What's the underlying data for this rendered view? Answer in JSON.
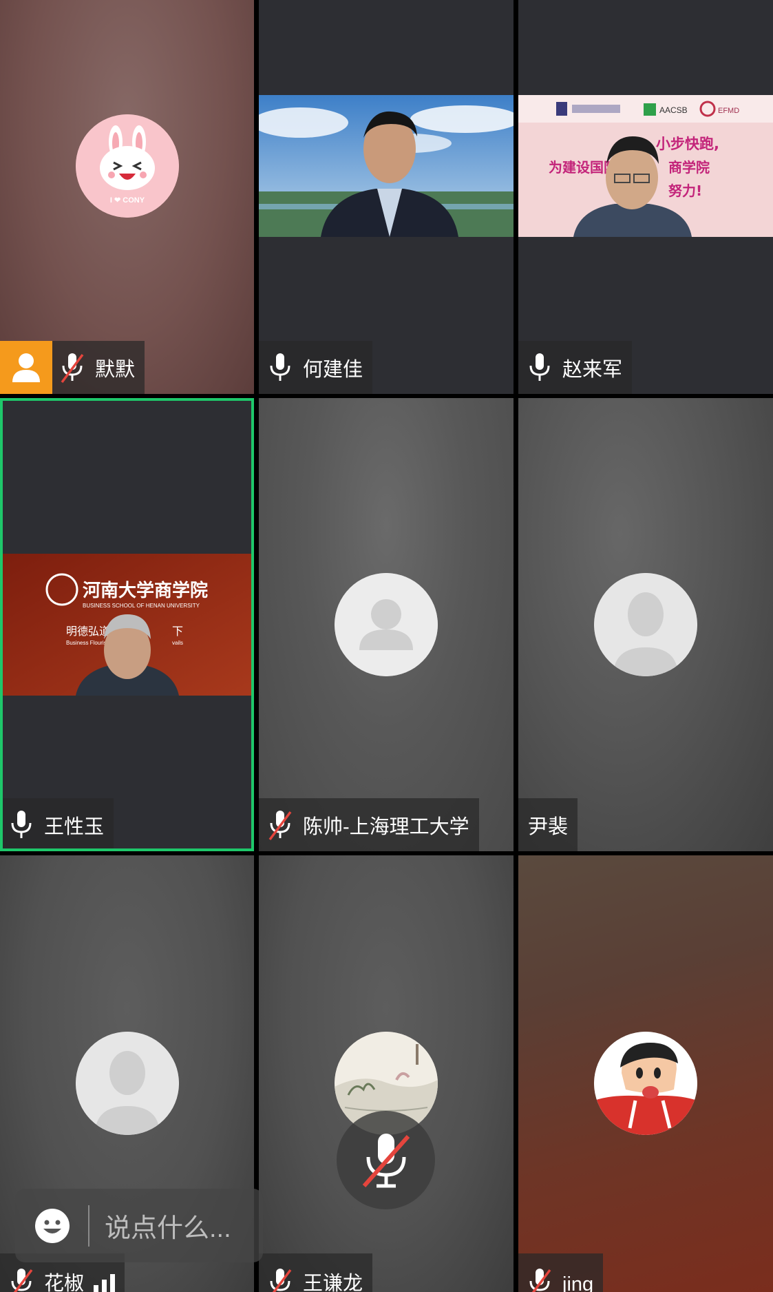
{
  "participants": [
    {
      "name": "默默",
      "mic": "muted",
      "tag": "host-person-icon"
    },
    {
      "name": "何建佳",
      "mic": "on"
    },
    {
      "name": "赵来军",
      "mic": "on"
    },
    {
      "name": "王性玉",
      "mic": "on",
      "selected": true
    },
    {
      "name": "陈帅-上海理工大学",
      "mic": "muted"
    },
    {
      "name": "尹裴",
      "mic": "none"
    },
    {
      "name": "花椒",
      "mic": "muted"
    },
    {
      "name": "王谦龙",
      "mic": "muted"
    },
    {
      "name": "jing",
      "mic": "muted"
    }
  ],
  "video_banners": {
    "zhao_line1": "小步快跑,",
    "zhao_line2": "为建设国际",
    "zhao_line2b": "商学院",
    "zhao_line3": "努力!",
    "zhao_logo2": "AACSB",
    "zhao_logo3": "EFMD",
    "henan_title": "河南大学商学院",
    "henan_subtitle": "BUSINESS SCHOOL OF HENAN UNIVERSITY",
    "henan_motto": "明德弘道",
    "henan_motto2": "下",
    "henan_motto_en": "Business Flourish",
    "henan_motto_en2": "vails"
  },
  "avatar_text": {
    "cony": "I ❤ CONY"
  },
  "chat": {
    "placeholder": "说点什么..."
  },
  "colors": {
    "selected_border": "#1ec76a",
    "host_tag": "#f59a1c",
    "muted_slash": "#e5453d"
  }
}
